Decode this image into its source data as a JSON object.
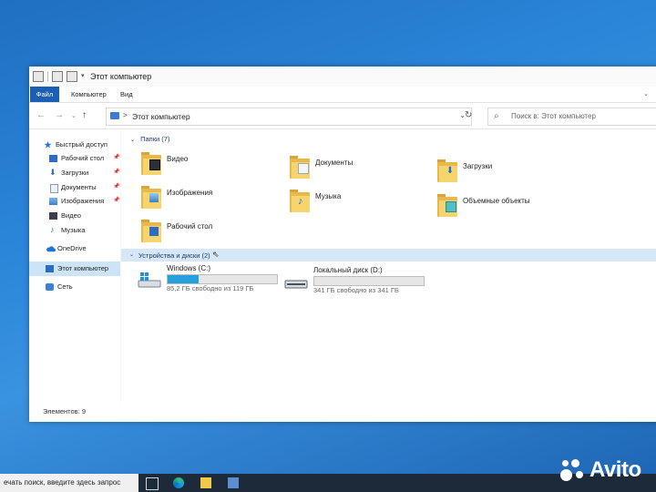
{
  "window": {
    "title": "Этот компьютер",
    "tabs": [
      {
        "label": "Файл",
        "active": true
      },
      {
        "label": "Компьютер",
        "active": false
      },
      {
        "label": "Вид",
        "active": false
      }
    ]
  },
  "address": {
    "breadcrumb_sep": ">",
    "path": "Этот компьютер",
    "search_placeholder": "Поиск в: Этот компьютер"
  },
  "sidebar": {
    "items": [
      {
        "label": "Быстрый доступ",
        "icon": "star-icon",
        "pinned": false
      },
      {
        "label": "Рабочий стол",
        "icon": "desktop-icon",
        "pinned": true
      },
      {
        "label": "Загрузки",
        "icon": "download-icon",
        "pinned": true
      },
      {
        "label": "Документы",
        "icon": "document-icon",
        "pinned": true
      },
      {
        "label": "Изображения",
        "icon": "image-icon",
        "pinned": true
      },
      {
        "label": "Видео",
        "icon": "video-icon",
        "pinned": false
      },
      {
        "label": "Музыка",
        "icon": "music-icon",
        "pinned": false
      },
      {
        "label": "OneDrive",
        "icon": "cloud-icon",
        "pinned": false
      },
      {
        "label": "Этот компьютер",
        "icon": "computer-icon",
        "pinned": false,
        "selected": true
      },
      {
        "label": "Сеть",
        "icon": "network-icon",
        "pinned": false
      }
    ]
  },
  "folders_group": {
    "label": "Папки (7)",
    "items": [
      {
        "label": "Видео",
        "badge": "video-icon"
      },
      {
        "label": "Документы",
        "badge": "document-icon"
      },
      {
        "label": "Загрузки",
        "badge": "download-icon"
      },
      {
        "label": "Изображения",
        "badge": "image-icon"
      },
      {
        "label": "Музыка",
        "badge": "music-icon"
      },
      {
        "label": "Объемные объекты",
        "badge": "cube-icon"
      },
      {
        "label": "Рабочий стол",
        "badge": "desktop-icon"
      }
    ]
  },
  "devices_group": {
    "label": "Устройства и диски (2)",
    "drives": [
      {
        "name": "Windows (C:)",
        "info": "85,2 ГБ свободно из 119 ГБ",
        "used_fraction": 0.284,
        "icon": "windows-drive-icon"
      },
      {
        "name": "Локальный диск (D:)",
        "info": "341 ГБ свободно из 341 ГБ",
        "used_fraction": 0.0,
        "icon": "drive-icon"
      }
    ]
  },
  "status": {
    "items_count": "Элементов: 9"
  },
  "taskbar": {
    "search_text": "ечать поиск, введите здесь запрос"
  },
  "watermark": {
    "text": "Avito"
  },
  "colors": {
    "accent": "#1a5fb4",
    "selected": "#cde4f7",
    "drive_fill": "#26a0da",
    "folder": "#f7d46e"
  }
}
